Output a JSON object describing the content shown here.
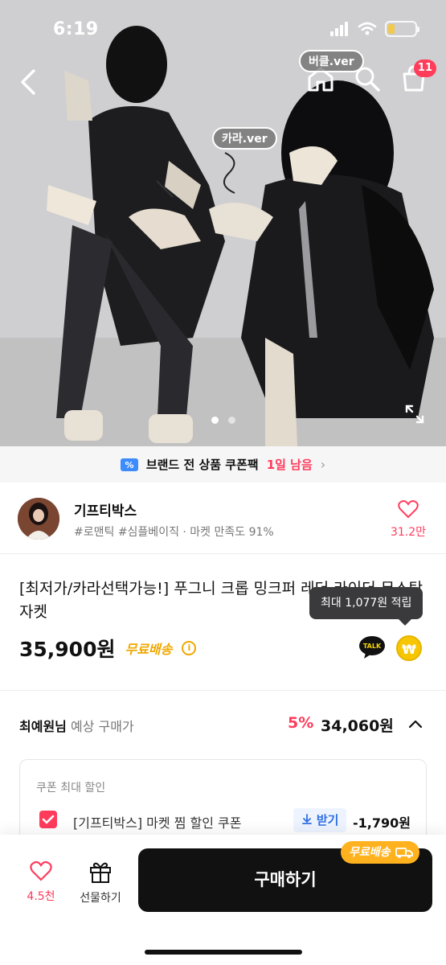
{
  "status_bar": {
    "time": "6:19"
  },
  "hero": {
    "tag_collar": "카라.ver",
    "tag_button": "버클.ver",
    "cart_count": "11",
    "slides_total": 2,
    "slide_active": 1
  },
  "promo": {
    "text": "브랜드 전 상품 쿠폰팩",
    "remaining": "1일 남음",
    "chevron": "›"
  },
  "seller": {
    "name": "기프티박스",
    "tags": "#로맨틱 #심플베이직 · 마켓 만족도 91%",
    "likes": "31.2만"
  },
  "product": {
    "title": "[최저가/카라선택가능!] 푸그니 크롭 밍크퍼 레더 라이더 무스탕 자켓",
    "price": "35,900원",
    "shipping": "무료배송",
    "info": "i",
    "talk_label": "TALK",
    "points_icon": "₩",
    "tooltip": "최대 1,077원 적립"
  },
  "expected": {
    "user": "최예원님",
    "label": "예상 구매가",
    "percent": "5%",
    "price": "34,060원"
  },
  "coupon": {
    "header": "쿠폰 최대 할인",
    "name": "[기프티박스] 마켓 찜 할인 쿠폰",
    "receive": "받기",
    "discount": "-1,790원"
  },
  "bottom": {
    "wish_count": "4.5천",
    "gift_label": "선물하기",
    "buy_label": "구매하기",
    "ship_badge": "무료배송"
  },
  "colors": {
    "accent_red": "#ff3b5c",
    "ship_yellow": "#f0a800",
    "buy_black": "#111111"
  }
}
